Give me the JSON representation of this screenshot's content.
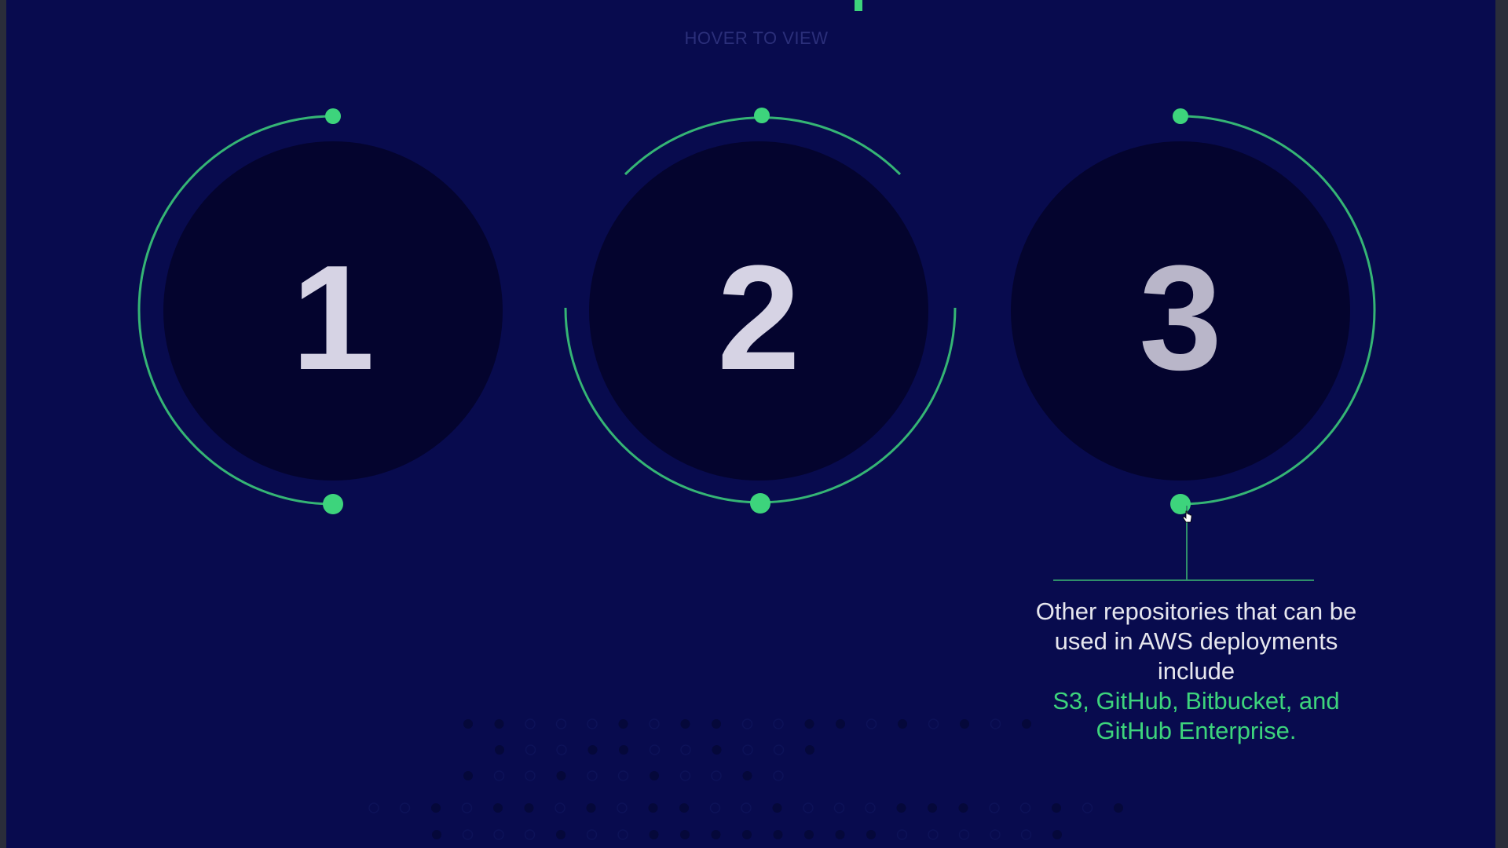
{
  "hint": "HOVER TO VIEW",
  "steps": [
    {
      "number": "1"
    },
    {
      "number": "2"
    },
    {
      "number": "3"
    }
  ],
  "info": {
    "text": "Other repositories that can be used in AWS deployments include",
    "highlight": "S3, GitHub, Bitbucket, and GitHub Enterprise."
  },
  "colors": {
    "background": "#080b4e",
    "circle": "#04042e",
    "accent": "#3dd47c",
    "number": "#d6d3e4"
  }
}
